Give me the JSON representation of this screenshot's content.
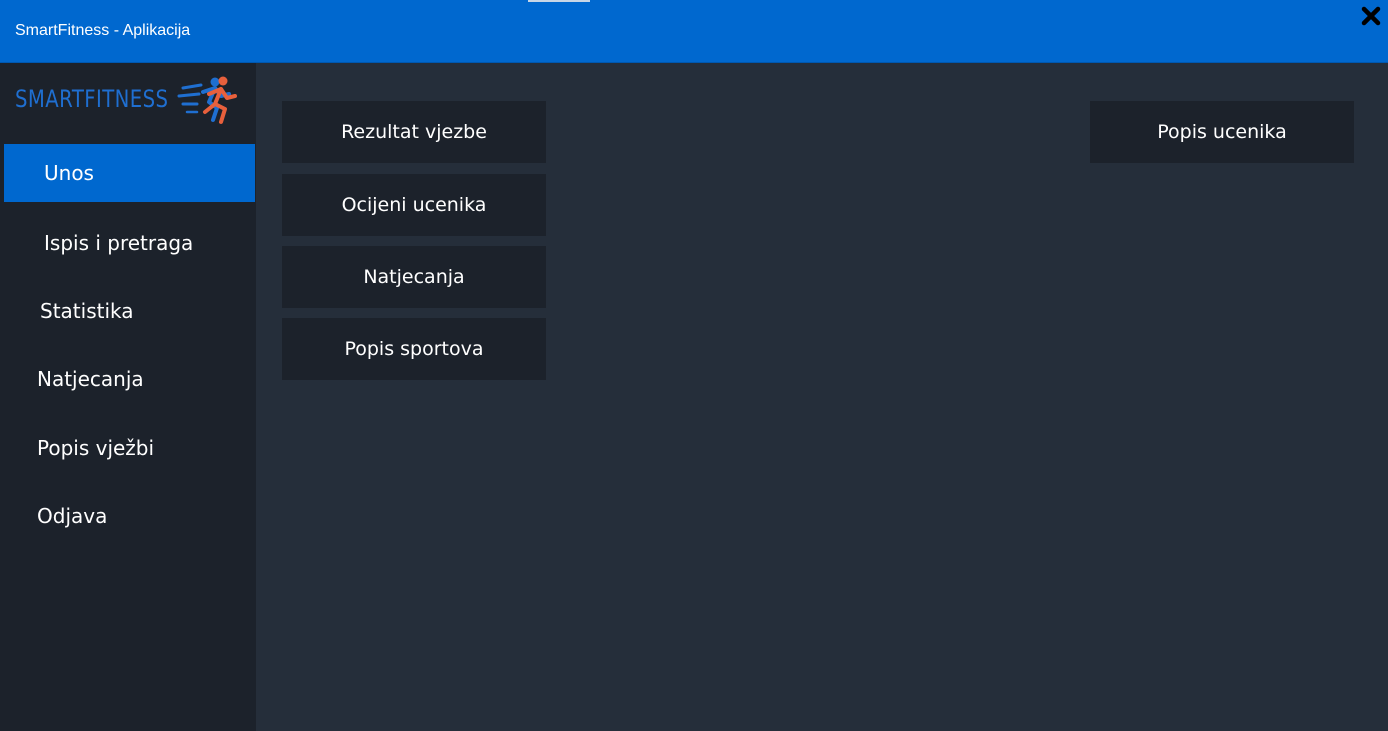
{
  "window": {
    "title": "SmartFitness - Aplikacija",
    "close_icon": "close-icon"
  },
  "sidebar": {
    "logo_text": "SMARTFITNESS",
    "logo_icon": "runner-icon",
    "items": [
      {
        "label": "Unos",
        "active": true
      },
      {
        "label": "Ispis i pretraga",
        "active": false
      },
      {
        "label": "Statistika",
        "active": false
      },
      {
        "label": "Natjecanja",
        "active": false
      },
      {
        "label": "Popis vježbi",
        "active": false
      },
      {
        "label": "Odjava",
        "active": false
      }
    ]
  },
  "main": {
    "buttons": [
      {
        "label": "Rezultat vjezbe"
      },
      {
        "label": "Ocijeni ucenika"
      },
      {
        "label": "Natjecanja"
      },
      {
        "label": "Popis sportova"
      }
    ],
    "right_button": {
      "label": "Popis ucenika"
    }
  },
  "colors": {
    "titlebar": "#0068cf",
    "sidebar_bg": "#1c222b",
    "content_bg": "#252e3a",
    "active_item": "#0068cf",
    "logo_blue": "#1f6fd1",
    "logo_orange": "#e8603c"
  }
}
